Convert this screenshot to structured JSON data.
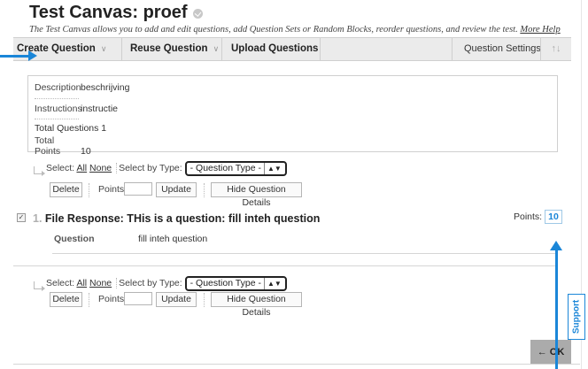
{
  "header": {
    "title": "Test Canvas: proef",
    "description": "The Test Canvas allows you to add and edit questions, add Question Sets or Random Blocks, reorder questions, and review the test.",
    "more_help": "More Help"
  },
  "toolbar": {
    "create_question": "Create Question",
    "reuse_question": "Reuse Question",
    "upload_questions": "Upload Questions",
    "question_settings": "Question Settings",
    "sort_icon": "↑↓"
  },
  "info": {
    "description_label": "Description",
    "description_value": "beschrijving",
    "instructions_label": "Instructions",
    "instructions_value": "instructie",
    "total_questions_label": "Total Questions",
    "total_questions_value": "1",
    "total_points_label": "Total Points",
    "total_points_value": "10"
  },
  "controls": {
    "select_label": "Select:",
    "all": "All",
    "none": "None",
    "select_by_type": "Select by Type:",
    "question_type": "- Question Type -",
    "delete": "Delete",
    "points": "Points",
    "update": "Update",
    "hide_details": "Hide Question Details"
  },
  "question": {
    "checkmark": "✓",
    "number": "1.",
    "title": "File Response: THis is a question: fill inteh question",
    "points_label": "Points:",
    "points_value": "10",
    "question_label": "Question",
    "question_text": "fill inteh question"
  },
  "support": "Support",
  "ok": "← OK",
  "colors": {
    "accent": "#1a86d8",
    "toolbar_bg": "#ebebeb",
    "ok_bg": "#ababab"
  }
}
